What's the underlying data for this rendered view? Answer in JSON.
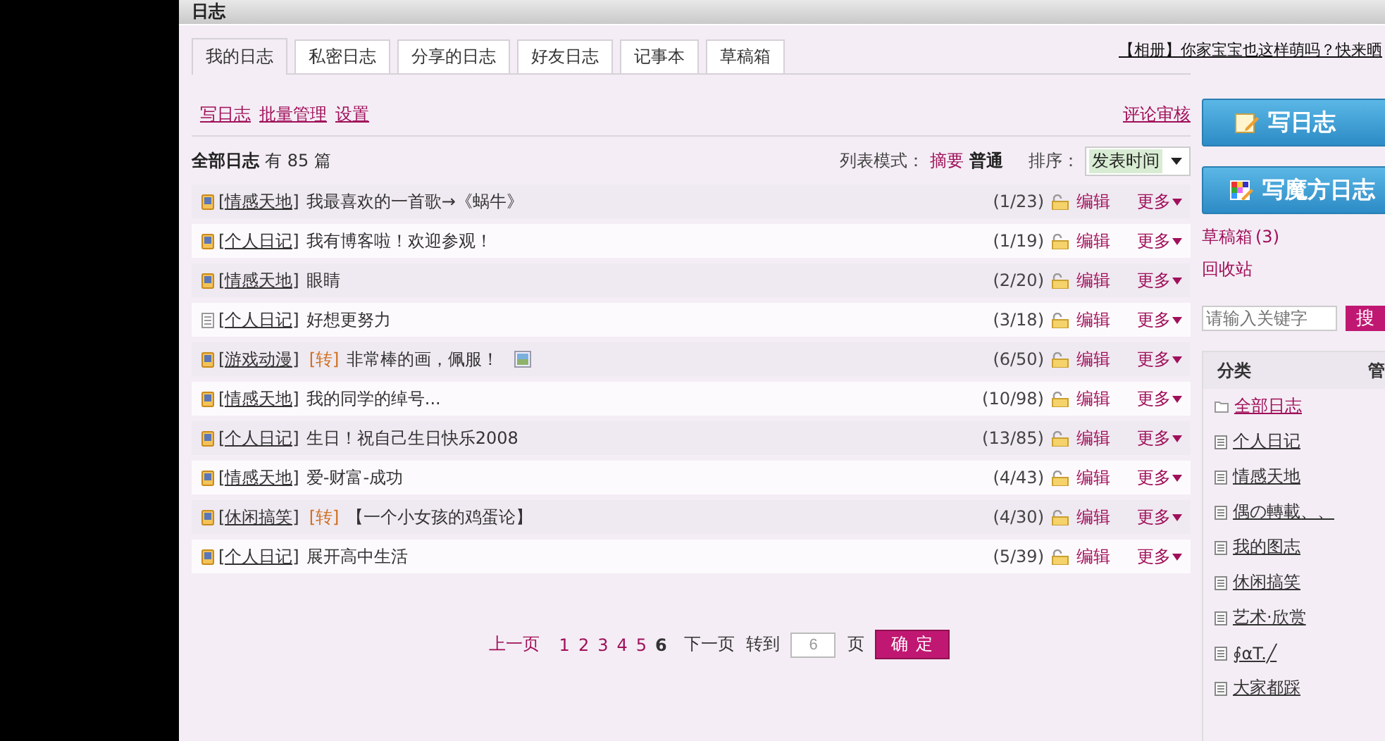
{
  "header": {
    "title": "日志"
  },
  "tabs": [
    {
      "label": "我的日志",
      "selected": true
    },
    {
      "label": "私密日志",
      "selected": false
    },
    {
      "label": "分享的日志",
      "selected": false
    },
    {
      "label": "好友日志",
      "selected": false
    },
    {
      "label": "记事本",
      "selected": false
    },
    {
      "label": "草稿箱",
      "selected": false
    }
  ],
  "promo_link": "【相册】你家宝宝也这样萌吗？快来晒",
  "actions": [
    "写日志",
    "批量管理",
    "设置"
  ],
  "review_link": "评论审核",
  "list_header": {
    "title": "全部日志",
    "count": "有 85 篇",
    "mode_label": "列表模式：",
    "modes": [
      {
        "label": "摘要",
        "selected": false
      },
      {
        "label": "普通",
        "selected": true
      }
    ],
    "sort_label": "排序：",
    "sort_value": "发表时间"
  },
  "posts": [
    {
      "kind": "public",
      "category": "[情感天地]",
      "title": "我最喜欢的一首歌→《蜗牛》",
      "has_image": false,
      "stats": "(1/23)",
      "edit": "编辑",
      "more": "更多"
    },
    {
      "kind": "public",
      "category": "[个人日记]",
      "title": "我有博客啦！欢迎参观！",
      "has_image": false,
      "stats": "(1/19)",
      "edit": "编辑",
      "more": "更多"
    },
    {
      "kind": "public",
      "category": "[情感天地]",
      "title": "眼睛",
      "has_image": false,
      "stats": "(2/20)",
      "edit": "编辑",
      "more": "更多"
    },
    {
      "kind": "plain",
      "category": "[个人日记]",
      "title": "好想更努力",
      "has_image": false,
      "stats": "(3/18)",
      "edit": "编辑",
      "more": "更多"
    },
    {
      "kind": "public",
      "category": "[游戏动漫]",
      "repost": "[转]",
      "title": "非常棒的画，佩服！",
      "has_image": true,
      "stats": "(6/50)",
      "edit": "编辑",
      "more": "更多"
    },
    {
      "kind": "public",
      "category": "[情感天地]",
      "title": "我的同学的绰号...",
      "has_image": false,
      "stats": "(10/98)",
      "edit": "编辑",
      "more": "更多"
    },
    {
      "kind": "public",
      "category": "[个人日记]",
      "title": "生日！祝自己生日快乐2008",
      "has_image": false,
      "stats": "(13/85)",
      "edit": "编辑",
      "more": "更多"
    },
    {
      "kind": "public",
      "category": "[情感天地]",
      "title": "爱-财富-成功",
      "has_image": false,
      "stats": "(4/43)",
      "edit": "编辑",
      "more": "更多"
    },
    {
      "kind": "public",
      "category": "[休闲搞笑]",
      "repost": "[转]",
      "title": "【一个小女孩的鸡蛋论】",
      "has_image": false,
      "stats": "(4/30)",
      "edit": "编辑",
      "more": "更多"
    },
    {
      "kind": "public",
      "category": "[个人日记]",
      "title": "展开高中生活",
      "has_image": false,
      "stats": "(5/39)",
      "edit": "编辑",
      "more": "更多"
    }
  ],
  "pagination": {
    "prev": "上一页",
    "pages": [
      {
        "label": "1",
        "selected": false
      },
      {
        "label": "2",
        "selected": false
      },
      {
        "label": "3",
        "selected": false
      },
      {
        "label": "4",
        "selected": false
      },
      {
        "label": "5",
        "selected": false
      },
      {
        "label": "6",
        "selected": true
      }
    ],
    "next": "下一页",
    "goto_label": "转到",
    "goto_value": "6",
    "unit": "页",
    "confirm": "确 定"
  },
  "sidebar": {
    "write_button": "写日志",
    "magic_button": "写魔方日志",
    "drafts": "草稿箱",
    "drafts_count": "(3)",
    "recycle": "回收站",
    "search_placeholder": "请输入关键字",
    "search_button": "搜",
    "category_title": "分类",
    "category_manage": "管",
    "categories": [
      {
        "label": "全部日志",
        "kind": "folder",
        "selected": true
      },
      {
        "label": "个人日记",
        "kind": "list",
        "selected": false
      },
      {
        "label": "情感天地",
        "kind": "list",
        "selected": false
      },
      {
        "label": "偶の轉載、、",
        "kind": "list",
        "selected": false
      },
      {
        "label": "我的图志",
        "kind": "list",
        "selected": false
      },
      {
        "label": "休闲搞笑",
        "kind": "list",
        "selected": false
      },
      {
        "label": "艺术·欣赏",
        "kind": "list",
        "selected": false
      },
      {
        "label": "∮αT.╱",
        "kind": "list",
        "selected": false
      },
      {
        "label": "大家都踩",
        "kind": "list",
        "selected": false
      }
    ]
  }
}
